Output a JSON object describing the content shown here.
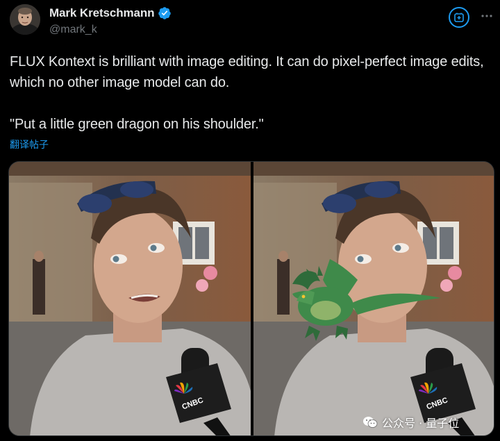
{
  "author": {
    "display_name": "Mark Kretschmann",
    "handle": "@mark_k",
    "verified": true
  },
  "tweet": {
    "paragraphs": [
      "FLUX Kontext is brilliant with image editing. It can do pixel-perfect image edits, which no other image model can do.",
      "\"Put a little green dragon on his shoulder.\""
    ],
    "translate_label": "翻译帖子"
  },
  "media": {
    "images": [
      {
        "alt": "original photo"
      },
      {
        "alt": "edited photo with green dragon"
      }
    ],
    "mic_logo_text": "CNBC"
  },
  "watermark": {
    "text": "公众号 · 量子位"
  },
  "icons": {
    "verified": "verified-badge-icon",
    "grok": "grok-icon",
    "more": "more-icon",
    "wechat": "wechat-icon"
  },
  "colors": {
    "accent": "#1d9bf0",
    "background": "#000000",
    "text": "#e7e9ea",
    "secondary_text": "#71767b",
    "dragon": "#3f8a4a"
  }
}
